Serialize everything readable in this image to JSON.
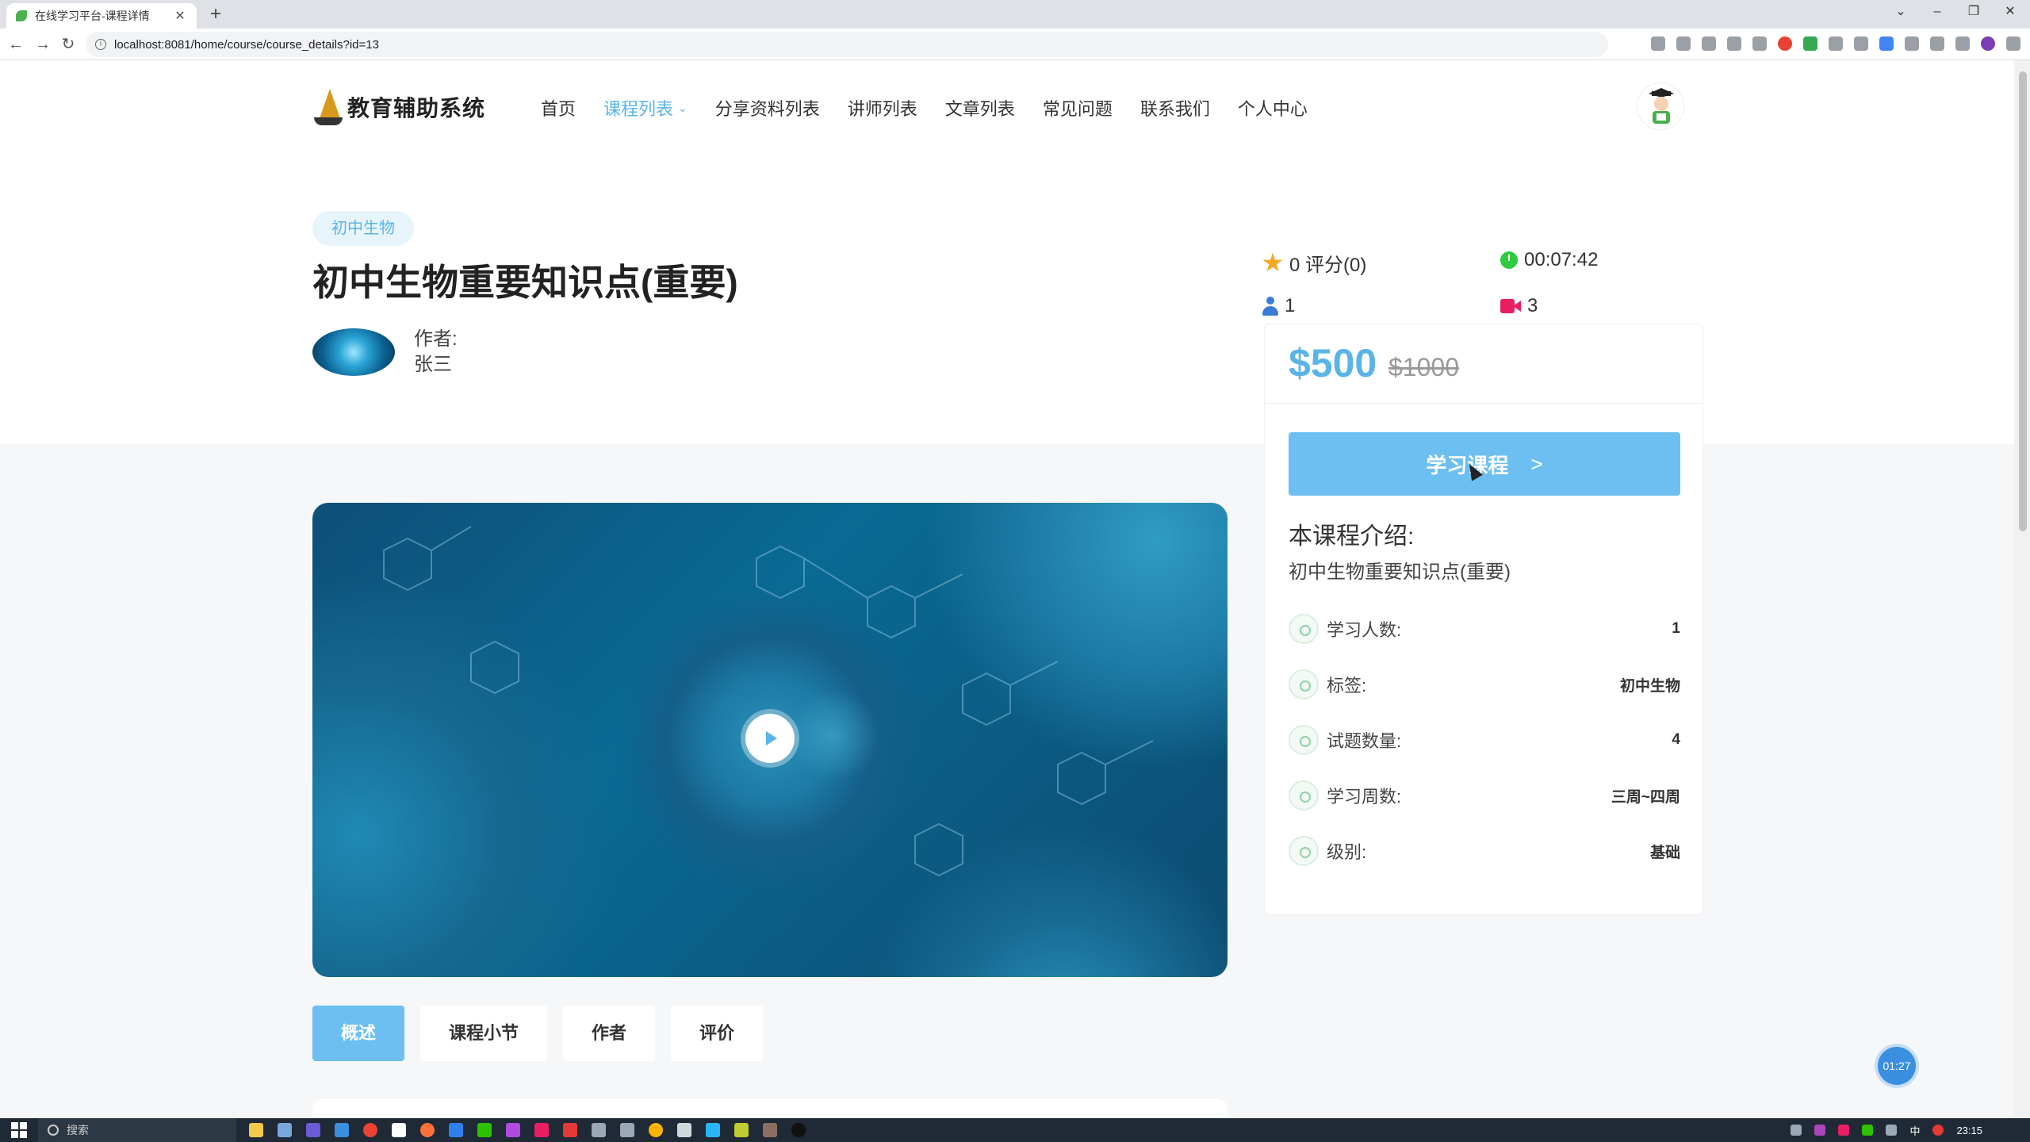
{
  "browser": {
    "tab_title": "在线学习平台-课程详情",
    "url": "localhost:8081/home/course/course_details?id=13"
  },
  "site": {
    "logo_text": "教育辅助系统",
    "nav": [
      {
        "label": "首页"
      },
      {
        "label": "课程列表",
        "active": true
      },
      {
        "label": "分享资料列表"
      },
      {
        "label": "讲师列表"
      },
      {
        "label": "文章列表"
      },
      {
        "label": "常见问题"
      },
      {
        "label": "联系我们"
      },
      {
        "label": "个人中心"
      }
    ]
  },
  "course": {
    "tag": "初中生物",
    "title": "初中生物重要知识点(重要)",
    "author_label": "作者:",
    "author_name": "张三",
    "rating": "0 评分(0)",
    "duration": "00:07:42",
    "students": "1",
    "videos": "3"
  },
  "sidebar": {
    "price": "$500",
    "old_price": "$1000",
    "study_button": "学习课程",
    "intro_heading": "本课程介绍:",
    "intro_text": "初中生物重要知识点(重要)",
    "info": [
      {
        "label": "学习人数:",
        "value": "1"
      },
      {
        "label": "标签:",
        "value": "初中生物"
      },
      {
        "label": "试题数量:",
        "value": "4"
      },
      {
        "label": "学习周数:",
        "value": "三周~四周"
      },
      {
        "label": "级别:",
        "value": "基础"
      }
    ]
  },
  "tabs": [
    {
      "label": "概述",
      "active": true
    },
    {
      "label": "课程小节"
    },
    {
      "label": "作者"
    },
    {
      "label": "评价"
    }
  ],
  "timer": "01:27",
  "taskbar": {
    "search_label": "搜索",
    "ime": "中",
    "time": "23:15"
  },
  "colors": {
    "accent": "#5ab4e8",
    "button": "#6cbff0",
    "rating_star": "#f5a623",
    "clock": "#2ecc40",
    "video_icon": "#e91e63",
    "user_icon": "#3a7bd5"
  }
}
